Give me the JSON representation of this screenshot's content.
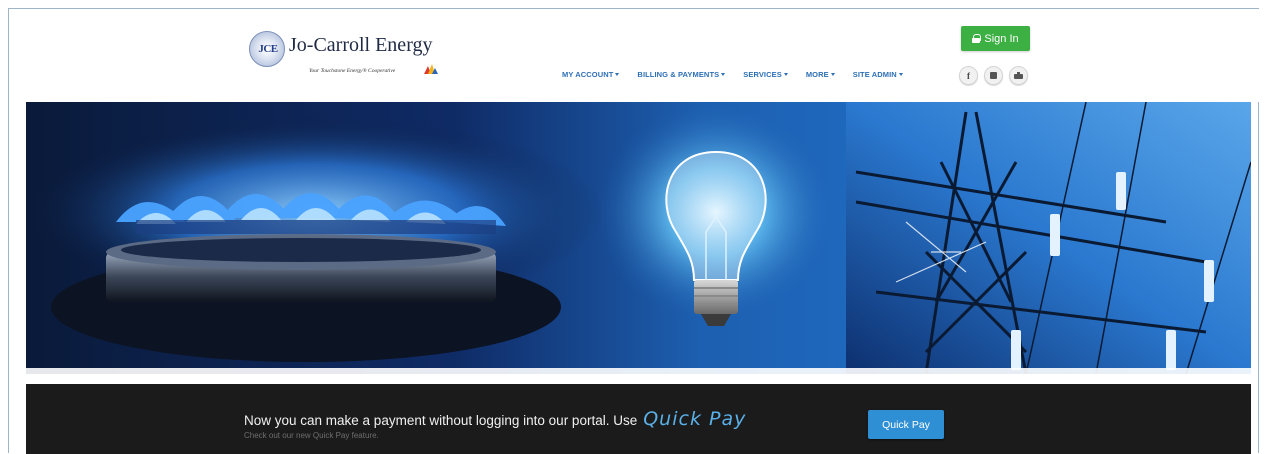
{
  "header": {
    "logo_badge": "JCE",
    "logo_name": "Jo-Carroll Energy",
    "logo_tagline": "Your Touchstone Energy® Cooperative",
    "signin_label": "Sign In"
  },
  "nav": {
    "items": [
      {
        "label": "MY ACCOUNT"
      },
      {
        "label": "BILLING & PAYMENTS"
      },
      {
        "label": "SERVICES"
      },
      {
        "label": "MORE"
      },
      {
        "label": "SITE ADMIN"
      }
    ]
  },
  "social": {
    "facebook": "f",
    "icons": [
      "facebook-icon",
      "linkedin-icon",
      "youtube-icon"
    ]
  },
  "quickpay": {
    "message": "Now you can make a payment without logging into our portal. Use",
    "script_text": "Quick Pay",
    "subtext": "Check out our new Quick Pay feature.",
    "button_label": "Quick Pay"
  },
  "colors": {
    "signin_green": "#3cb043",
    "nav_blue": "#2d6fb5",
    "quickpay_blue": "#2f8fd4",
    "bar_dark": "#1b1b1b"
  }
}
